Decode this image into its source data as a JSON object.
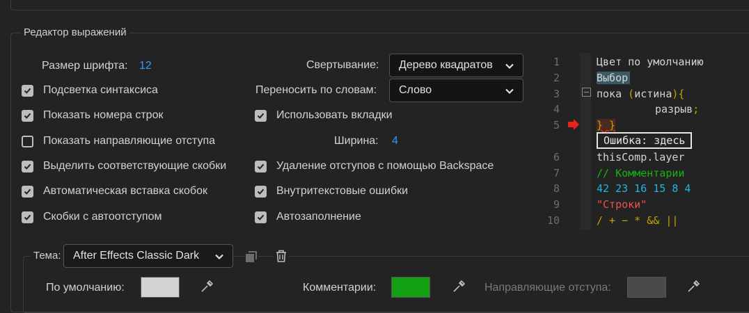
{
  "section_title": "Редактор выражений",
  "font_size": {
    "label": "Размер шрифта:",
    "value": "12"
  },
  "left_checks": [
    {
      "label": "Подсветка синтаксиса",
      "checked": true
    },
    {
      "label": "Показать номера строк",
      "checked": true
    },
    {
      "label": "Показать направляющие отступа",
      "checked": false
    },
    {
      "label": "Выделить соответствующие скобки",
      "checked": true
    },
    {
      "label": "Автоматическая вставка скобок",
      "checked": true
    },
    {
      "label": "Скобки с автоотступом",
      "checked": true
    }
  ],
  "folding": {
    "label": "Свертывание:",
    "value": "Дерево квадратов"
  },
  "word_wrap": {
    "label": "Переносить по словам:",
    "value": "Слово"
  },
  "use_tabs": {
    "label": "Использовать вкладки",
    "checked": true
  },
  "tab_width": {
    "label": "Ширина:",
    "value": "4"
  },
  "mid_checks": [
    {
      "label": "Удаление отступов с помощью Backspace",
      "checked": true
    },
    {
      "label": "Внутритекстовые ошибки",
      "checked": true
    },
    {
      "label": "Автозаполнение",
      "checked": true
    }
  ],
  "preview": {
    "line_numbers": [
      "1",
      "2",
      "3",
      "4",
      "5",
      "6",
      "7",
      "8",
      "9",
      "10"
    ],
    "line1": "Цвет по умолчанию",
    "line2": "Выбор",
    "line3_kw": "пока",
    "line3_paren_open": "(",
    "line3_ident": "истина",
    "line3_paren_close": ")",
    "line3_brace": "{",
    "line4": "разрыв",
    "line4_semi": ";",
    "line5": "} }",
    "error_text": "Ошибка: здесь",
    "line6": "thisComp.layer",
    "line7": "// Комментарии",
    "line8": "42 23 16 15 8 4",
    "line9": "\"Строки\"",
    "line10": "/ + − * && ||",
    "colors": {
      "default": "#d4d4d4",
      "selection_bg": "#3c5a64",
      "keyword": "#d2d2d2",
      "paren": "#c8a000",
      "comment": "#12b312",
      "number": "#1fb5e0",
      "string": "#f05050",
      "operator": "#c8a000",
      "error_marker": "#e8231a"
    }
  },
  "theme": {
    "label": "Тема:",
    "value": "After Effects Classic Dark"
  },
  "swatches": [
    {
      "label": "По умолчанию:",
      "color": "#d2d2d2"
    },
    {
      "label": "Комментарии:",
      "color": "#12a012"
    },
    {
      "label": "Направляющие отступа:",
      "color": "#4a4a4a"
    }
  ]
}
